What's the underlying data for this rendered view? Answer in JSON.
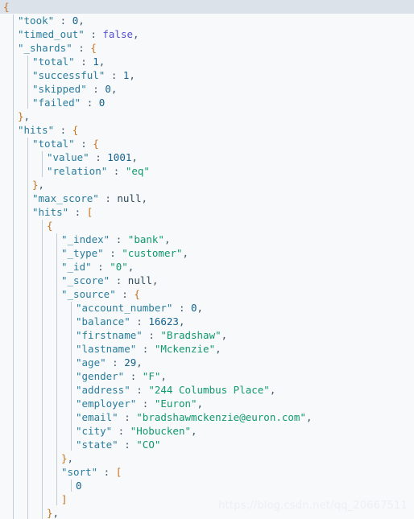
{
  "editor": {
    "title": "Elasticsearch search response (JSON)",
    "current_line_index": 0,
    "colors": {
      "background": "#f7f9fb",
      "current_line": "#dbe2ea",
      "key": "#2a7d9c",
      "string": "#11996b",
      "number": "#15628d",
      "boolean": "#5252cc",
      "null": "#2f4a5c",
      "punctuation": "#3d5566",
      "brace": "#c8731c",
      "indent_guide": "#c2ccd6"
    },
    "indent_guides_x": [
      18,
      36,
      54,
      72,
      90
    ]
  },
  "watermark": {
    "text": "https://blog.csdn.net/qq_20667511"
  },
  "json_response": {
    "took": 0,
    "timed_out": false,
    "_shards": {
      "total": 1,
      "successful": 1,
      "skipped": 0,
      "failed": 0
    },
    "hits": {
      "total": {
        "value": 1001,
        "relation": "eq"
      },
      "max_score": null,
      "hits": [
        {
          "_index": "bank",
          "_type": "customer",
          "_id": "0",
          "_score": null,
          "_source": {
            "account_number": 0,
            "balance": 16623,
            "firstname": "Bradshaw",
            "lastname": "Mckenzie",
            "age": 29,
            "gender": "F",
            "address": "244 Columbus Place",
            "employer": "Euron",
            "email": "bradshawmckenzie@euron.com",
            "city": "Hobucken",
            "state": "CO"
          },
          "sort": [
            0
          ]
        }
      ]
    }
  },
  "lines": [
    {
      "indent": 0,
      "tokens": [
        {
          "t": "br",
          "v": "{"
        }
      ]
    },
    {
      "indent": 1,
      "tokens": [
        {
          "t": "k",
          "v": "\"took\""
        },
        {
          "t": "p",
          "v": " : "
        },
        {
          "t": "n",
          "v": "0"
        },
        {
          "t": "p",
          "v": ","
        }
      ]
    },
    {
      "indent": 1,
      "tokens": [
        {
          "t": "k",
          "v": "\"timed_out\""
        },
        {
          "t": "p",
          "v": " : "
        },
        {
          "t": "b",
          "v": "false"
        },
        {
          "t": "p",
          "v": ","
        }
      ]
    },
    {
      "indent": 1,
      "tokens": [
        {
          "t": "k",
          "v": "\"_shards\""
        },
        {
          "t": "p",
          "v": " : "
        },
        {
          "t": "br",
          "v": "{"
        }
      ]
    },
    {
      "indent": 2,
      "tokens": [
        {
          "t": "k",
          "v": "\"total\""
        },
        {
          "t": "p",
          "v": " : "
        },
        {
          "t": "n",
          "v": "1"
        },
        {
          "t": "p",
          "v": ","
        }
      ]
    },
    {
      "indent": 2,
      "tokens": [
        {
          "t": "k",
          "v": "\"successful\""
        },
        {
          "t": "p",
          "v": " : "
        },
        {
          "t": "n",
          "v": "1"
        },
        {
          "t": "p",
          "v": ","
        }
      ]
    },
    {
      "indent": 2,
      "tokens": [
        {
          "t": "k",
          "v": "\"skipped\""
        },
        {
          "t": "p",
          "v": " : "
        },
        {
          "t": "n",
          "v": "0"
        },
        {
          "t": "p",
          "v": ","
        }
      ]
    },
    {
      "indent": 2,
      "tokens": [
        {
          "t": "k",
          "v": "\"failed\""
        },
        {
          "t": "p",
          "v": " : "
        },
        {
          "t": "n",
          "v": "0"
        }
      ]
    },
    {
      "indent": 1,
      "tokens": [
        {
          "t": "br",
          "v": "}"
        },
        {
          "t": "p",
          "v": ","
        }
      ]
    },
    {
      "indent": 1,
      "tokens": [
        {
          "t": "k",
          "v": "\"hits\""
        },
        {
          "t": "p",
          "v": " : "
        },
        {
          "t": "br",
          "v": "{"
        }
      ]
    },
    {
      "indent": 2,
      "tokens": [
        {
          "t": "k",
          "v": "\"total\""
        },
        {
          "t": "p",
          "v": " : "
        },
        {
          "t": "br",
          "v": "{"
        }
      ]
    },
    {
      "indent": 3,
      "tokens": [
        {
          "t": "k",
          "v": "\"value\""
        },
        {
          "t": "p",
          "v": " : "
        },
        {
          "t": "n",
          "v": "1001"
        },
        {
          "t": "p",
          "v": ","
        }
      ]
    },
    {
      "indent": 3,
      "tokens": [
        {
          "t": "k",
          "v": "\"relation\""
        },
        {
          "t": "p",
          "v": " : "
        },
        {
          "t": "s",
          "v": "\"eq\""
        }
      ]
    },
    {
      "indent": 2,
      "tokens": [
        {
          "t": "br",
          "v": "}"
        },
        {
          "t": "p",
          "v": ","
        }
      ]
    },
    {
      "indent": 2,
      "tokens": [
        {
          "t": "k",
          "v": "\"max_score\""
        },
        {
          "t": "p",
          "v": " : "
        },
        {
          "t": "nl",
          "v": "null"
        },
        {
          "t": "p",
          "v": ","
        }
      ]
    },
    {
      "indent": 2,
      "tokens": [
        {
          "t": "k",
          "v": "\"hits\""
        },
        {
          "t": "p",
          "v": " : "
        },
        {
          "t": "br",
          "v": "["
        }
      ]
    },
    {
      "indent": 3,
      "tokens": [
        {
          "t": "br",
          "v": "{"
        }
      ]
    },
    {
      "indent": 4,
      "tokens": [
        {
          "t": "k",
          "v": "\"_index\""
        },
        {
          "t": "p",
          "v": " : "
        },
        {
          "t": "s",
          "v": "\"bank\""
        },
        {
          "t": "p",
          "v": ","
        }
      ]
    },
    {
      "indent": 4,
      "tokens": [
        {
          "t": "k",
          "v": "\"_type\""
        },
        {
          "t": "p",
          "v": " : "
        },
        {
          "t": "s",
          "v": "\"customer\""
        },
        {
          "t": "p",
          "v": ","
        }
      ]
    },
    {
      "indent": 4,
      "tokens": [
        {
          "t": "k",
          "v": "\"_id\""
        },
        {
          "t": "p",
          "v": " : "
        },
        {
          "t": "s",
          "v": "\"0\""
        },
        {
          "t": "p",
          "v": ","
        }
      ]
    },
    {
      "indent": 4,
      "tokens": [
        {
          "t": "k",
          "v": "\"_score\""
        },
        {
          "t": "p",
          "v": " : "
        },
        {
          "t": "nl",
          "v": "null"
        },
        {
          "t": "p",
          "v": ","
        }
      ]
    },
    {
      "indent": 4,
      "tokens": [
        {
          "t": "k",
          "v": "\"_source\""
        },
        {
          "t": "p",
          "v": " : "
        },
        {
          "t": "br",
          "v": "{"
        }
      ]
    },
    {
      "indent": 5,
      "tokens": [
        {
          "t": "k",
          "v": "\"account_number\""
        },
        {
          "t": "p",
          "v": " : "
        },
        {
          "t": "n",
          "v": "0"
        },
        {
          "t": "p",
          "v": ","
        }
      ]
    },
    {
      "indent": 5,
      "tokens": [
        {
          "t": "k",
          "v": "\"balance\""
        },
        {
          "t": "p",
          "v": " : "
        },
        {
          "t": "n",
          "v": "16623"
        },
        {
          "t": "p",
          "v": ","
        }
      ]
    },
    {
      "indent": 5,
      "tokens": [
        {
          "t": "k",
          "v": "\"firstname\""
        },
        {
          "t": "p",
          "v": " : "
        },
        {
          "t": "s",
          "v": "\"Bradshaw\""
        },
        {
          "t": "p",
          "v": ","
        }
      ]
    },
    {
      "indent": 5,
      "tokens": [
        {
          "t": "k",
          "v": "\"lastname\""
        },
        {
          "t": "p",
          "v": " : "
        },
        {
          "t": "s",
          "v": "\"Mckenzie\""
        },
        {
          "t": "p",
          "v": ","
        }
      ]
    },
    {
      "indent": 5,
      "tokens": [
        {
          "t": "k",
          "v": "\"age\""
        },
        {
          "t": "p",
          "v": " : "
        },
        {
          "t": "n",
          "v": "29"
        },
        {
          "t": "p",
          "v": ","
        }
      ]
    },
    {
      "indent": 5,
      "tokens": [
        {
          "t": "k",
          "v": "\"gender\""
        },
        {
          "t": "p",
          "v": " : "
        },
        {
          "t": "s",
          "v": "\"F\""
        },
        {
          "t": "p",
          "v": ","
        }
      ]
    },
    {
      "indent": 5,
      "tokens": [
        {
          "t": "k",
          "v": "\"address\""
        },
        {
          "t": "p",
          "v": " : "
        },
        {
          "t": "s",
          "v": "\"244 Columbus Place\""
        },
        {
          "t": "p",
          "v": ","
        }
      ]
    },
    {
      "indent": 5,
      "tokens": [
        {
          "t": "k",
          "v": "\"employer\""
        },
        {
          "t": "p",
          "v": " : "
        },
        {
          "t": "s",
          "v": "\"Euron\""
        },
        {
          "t": "p",
          "v": ","
        }
      ]
    },
    {
      "indent": 5,
      "tokens": [
        {
          "t": "k",
          "v": "\"email\""
        },
        {
          "t": "p",
          "v": " : "
        },
        {
          "t": "s",
          "v": "\"bradshawmckenzie@euron.com\""
        },
        {
          "t": "p",
          "v": ","
        }
      ]
    },
    {
      "indent": 5,
      "tokens": [
        {
          "t": "k",
          "v": "\"city\""
        },
        {
          "t": "p",
          "v": " : "
        },
        {
          "t": "s",
          "v": "\"Hobucken\""
        },
        {
          "t": "p",
          "v": ","
        }
      ]
    },
    {
      "indent": 5,
      "tokens": [
        {
          "t": "k",
          "v": "\"state\""
        },
        {
          "t": "p",
          "v": " : "
        },
        {
          "t": "s",
          "v": "\"CO\""
        }
      ]
    },
    {
      "indent": 4,
      "tokens": [
        {
          "t": "br",
          "v": "}"
        },
        {
          "t": "p",
          "v": ","
        }
      ]
    },
    {
      "indent": 4,
      "tokens": [
        {
          "t": "k",
          "v": "\"sort\""
        },
        {
          "t": "p",
          "v": " : "
        },
        {
          "t": "br",
          "v": "["
        }
      ]
    },
    {
      "indent": 5,
      "tokens": [
        {
          "t": "n",
          "v": "0"
        }
      ]
    },
    {
      "indent": 4,
      "tokens": [
        {
          "t": "br",
          "v": "]"
        }
      ]
    },
    {
      "indent": 3,
      "tokens": [
        {
          "t": "br",
          "v": "}"
        },
        {
          "t": "p",
          "v": ","
        }
      ]
    }
  ]
}
